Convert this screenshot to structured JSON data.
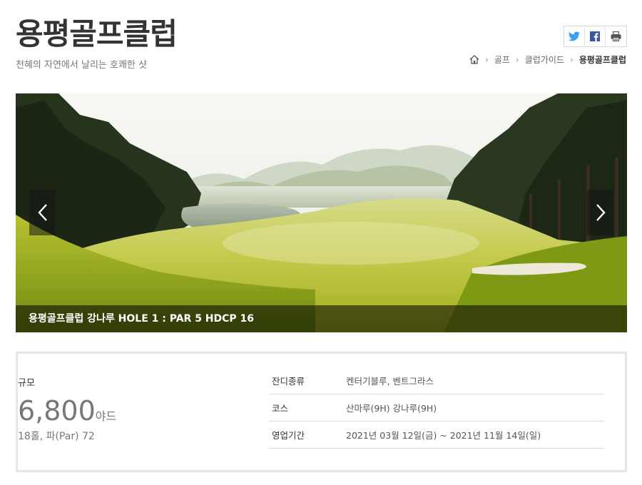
{
  "header": {
    "title": "용평골프클럽",
    "subtitle": "천혜의 자연에서 날리는 호쾌한 샷"
  },
  "share": {
    "icons": [
      "twitter-icon",
      "facebook-icon",
      "print-icon"
    ],
    "twitter_color": "#3aa1f0",
    "facebook_color": "#3b5998"
  },
  "breadcrumb": {
    "items": [
      "골프",
      "클럽가이드",
      "용평골프클럽"
    ]
  },
  "hero": {
    "caption": "용평골프클럽 강나루 HOLE 1 : PAR 5 HDCP 16"
  },
  "info": {
    "size_label": "규모",
    "size_number": "6,800",
    "size_unit": "야드",
    "size_detail": "18홀, 파(Par) 72",
    "specs": [
      {
        "label": "잔디종류",
        "value": "켄터기블루, 벤트그라스"
      },
      {
        "label": "코스",
        "value": "산마루(9H) 강나루(9H)"
      },
      {
        "label": "영업기간",
        "value": "2021년 03월 12일(금) ~ 2021년 11월 14일(일)"
      }
    ]
  }
}
